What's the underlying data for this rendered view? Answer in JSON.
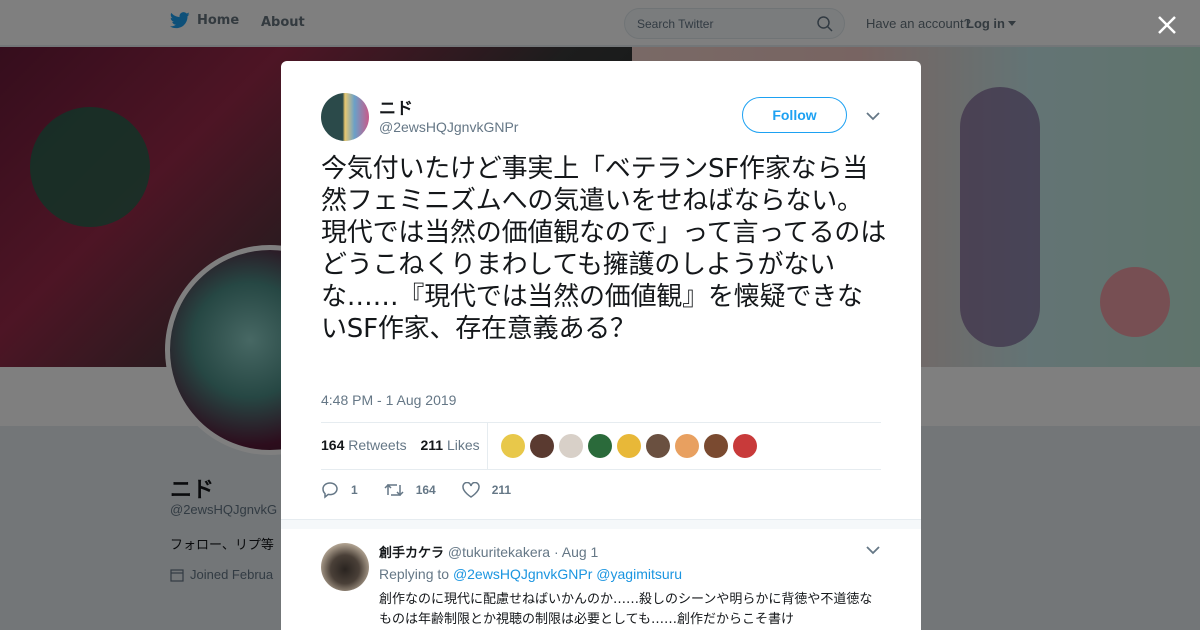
{
  "nav": {
    "home_label": "Home",
    "about_label": "About",
    "search_placeholder": "Search Twitter",
    "have_account": "Have an account?",
    "login_label": "Log in"
  },
  "background_profile": {
    "name": "ニド",
    "handle": "@2ewsHQJgnvkG",
    "bio": "フォロー、リプ等",
    "joined": "Joined Februa"
  },
  "tweet": {
    "name": "ニド",
    "handle": "@2ewsHQJgnvkGNPr",
    "follow_label": "Follow",
    "text": "今気付いたけど事実上「ベテランSF作家なら当然フェミニズムへの気遣いをせねばならない。現代では当然の価値観なので」って言ってるのはどうこねくりまわしても擁護のしようがないな……『現代では当然の価値観』を懐疑できないSF作家、存在意義ある？",
    "timestamp": "4:48 PM - 1 Aug 2019",
    "retweets_count": "164",
    "retweets_label": "Retweets",
    "likes_count": "211",
    "likes_label": "Likes",
    "likers_colors": [
      "#e8c84a",
      "#5a3a30",
      "#d8d0c8",
      "#2a6a3a",
      "#e8b838",
      "#6a5040",
      "#e8a060",
      "#7a4a30",
      "#c83a3a"
    ],
    "actions": {
      "reply_count": "1",
      "retweet_count": "164",
      "like_count": "211"
    }
  },
  "reply": {
    "name": "創手カケラ",
    "handle": "@tukuritekakera",
    "date": "· Aug 1",
    "replying_to_label": "Replying to",
    "replying_to_1": "@2ewsHQJgnvkGNPr",
    "replying_to_2": "@yagimitsuru",
    "text": "創作なのに現代に配慮せねばいかんのか……殺しのシーンや明らかに背徳や不道徳なものは年齢制限とか視聴の制限は必要としても……創作だからこそ書け"
  },
  "colors": {
    "accent": "#1da1f2",
    "text_secondary": "#657786",
    "twitter_blue": "#1da1f2"
  }
}
